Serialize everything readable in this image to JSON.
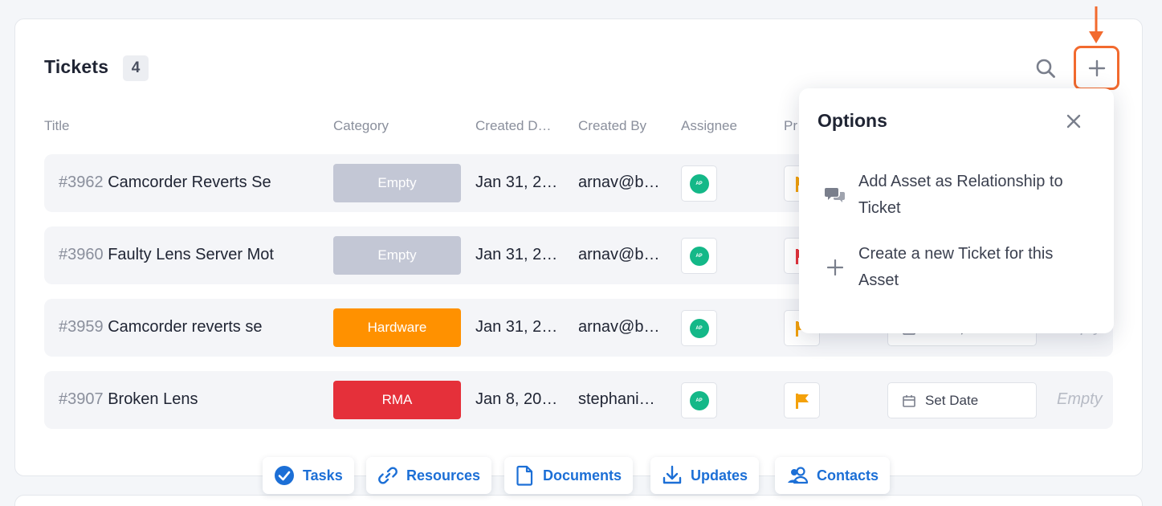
{
  "header": {
    "title": "Tickets",
    "count": "4"
  },
  "columns": {
    "title": "Title",
    "category": "Category",
    "created_date": "Created D…",
    "created_by": "Created By",
    "assignee": "Assignee",
    "priority": "Pr"
  },
  "rows": [
    {
      "number": "#3962",
      "title": "Camcorder Reverts Se",
      "category": "Empty",
      "category_color": "#c3c7d5",
      "date": "Jan 31, 2…",
      "created_by": "arnav@b…",
      "avatar": "AP",
      "priority_color": "#f4a10a",
      "due": "",
      "due_label": "",
      "extra": ""
    },
    {
      "number": "#3960",
      "title": "Faulty Lens Server Mot",
      "category": "Empty",
      "category_color": "#c3c7d5",
      "date": "Jan 31, 2…",
      "created_by": "arnav@b…",
      "avatar": "AP",
      "priority_color": "#e6323a",
      "due": "",
      "due_label": "",
      "extra": ""
    },
    {
      "number": "#3959",
      "title": "Camcorder reverts se",
      "category": "Hardware",
      "category_color": "#ff9100",
      "date": "Jan 31, 2…",
      "created_by": "arnav@b…",
      "avatar": "AP",
      "priority_color": "#f4a10a",
      "due": "Feb 5, 2024",
      "due_label": "",
      "extra": "Empty"
    },
    {
      "number": "#3907",
      "title": "Broken Lens",
      "category": "RMA",
      "category_color": "#e5303a",
      "date": "Jan 8, 20…",
      "created_by": "stephani…",
      "avatar": "AP",
      "priority_color": "#f4a10a",
      "due": "",
      "due_label": "Set Date",
      "extra": "Empty"
    }
  ],
  "popup": {
    "title": "Options",
    "options": [
      {
        "label": "Add Asset as Relationship to Ticket",
        "icon": "chat-bubbles-icon"
      },
      {
        "label": "Create a new Ticket for this Asset",
        "icon": "plus-icon"
      }
    ]
  },
  "tabs": [
    {
      "label": "Tasks",
      "icon": "check-circle-icon"
    },
    {
      "label": "Resources",
      "icon": "link-icon"
    },
    {
      "label": "Documents",
      "icon": "document-icon"
    },
    {
      "label": "Updates",
      "icon": "download-icon"
    },
    {
      "label": "Contacts",
      "icon": "users-icon"
    }
  ],
  "colors": {
    "accent": "#f26a2e",
    "link": "#1c6fd6",
    "avatar": "#14b888"
  }
}
